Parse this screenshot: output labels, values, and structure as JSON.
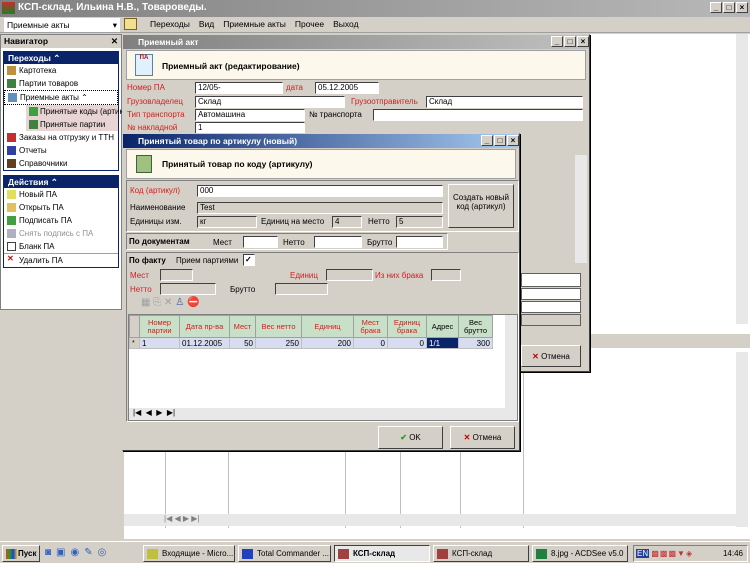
{
  "app": {
    "title": "КСП-склад. Ильина Н.В., Товароведы."
  },
  "toolbar": {
    "combo_value": "Приемные акты",
    "menu": [
      "Переходы",
      "Вид",
      "Приемные акты",
      "Прочее",
      "Выход"
    ]
  },
  "navigator": {
    "title": "Навигатор",
    "group1": "Переходы",
    "items": [
      "Картотека",
      "Партии товаров",
      "Приемные акты"
    ],
    "subitems": [
      "Принятые коды (артикулы)",
      "Принятые партии"
    ],
    "items2": [
      "Заказы на отгрузку и ТТН",
      "Отчеты",
      "Справочники"
    ],
    "group2": "Действия",
    "actions": [
      "Новый ПА",
      "Открыть ПА",
      "Подписать ПА",
      "Снять подпись с ПА",
      "Бланк ПА",
      "Удалить ПА"
    ]
  },
  "act": {
    "title": "Приемный акт",
    "banner": "Приемный акт (редактирование)",
    "icon_text": "ПА",
    "labels": {
      "number": "Номер ПА",
      "date": "дата",
      "owner": "Грузовладелец",
      "sender": "Грузоотправитель",
      "transport_type": "Тип транспорта",
      "transport_no": "№ транспорта",
      "invoice": "№ накладной"
    },
    "values": {
      "number": "12/05-",
      "date": "05.12.2005",
      "owner": "Склад",
      "sender": "Склад",
      "transport_type": "Автомашина",
      "transport_no": "",
      "invoice": "1"
    },
    "cancel": "Отмена"
  },
  "dlg": {
    "title": "Принятый товар по артикулу (новый)",
    "banner": "Принятый товар по коду (артикулу)",
    "code_label": "Код (артикул)",
    "code": "000",
    "name_label": "Наименование",
    "name": "Test",
    "units_label": "Единицы изм.",
    "units": "кг",
    "per_place_label": "Единиц на место",
    "per_place": "4",
    "netto_label": "Нетто",
    "netto": "5",
    "create_btn": "Создать новый код (артикул)",
    "docs": {
      "title": "По документам",
      "places": "Мест",
      "netto": "Нетто",
      "brutto": "Брутто"
    },
    "fact": {
      "title": "По факту",
      "batch_label": "Прием партиями",
      "batch_checked": true,
      "places": "Мест",
      "units": "Единиц",
      "defect": "Из них брака",
      "netto": "Нетто",
      "brutto": "Брутто"
    },
    "columns": [
      "Номер партии",
      "Дата пр-ва",
      "Мест",
      "Вес нетто",
      "Единиц",
      "Мест брака",
      "Единиц брака",
      "Адрес",
      "Вес брутто"
    ],
    "rows": [
      [
        "1",
        "01.12.2005",
        "50",
        "250",
        "200",
        "0",
        "0",
        "1/1",
        "300"
      ]
    ],
    "ok": "OK",
    "cancel": "Отмена"
  },
  "taskbar": {
    "start": "Пуск",
    "tasks": [
      "Входящие - Micro...",
      "Total Commander ...",
      "КСП-склад",
      "КСП-склад",
      "8.jpg - ACDSee v5.0"
    ],
    "lang": "EN",
    "clock": "14:46"
  }
}
